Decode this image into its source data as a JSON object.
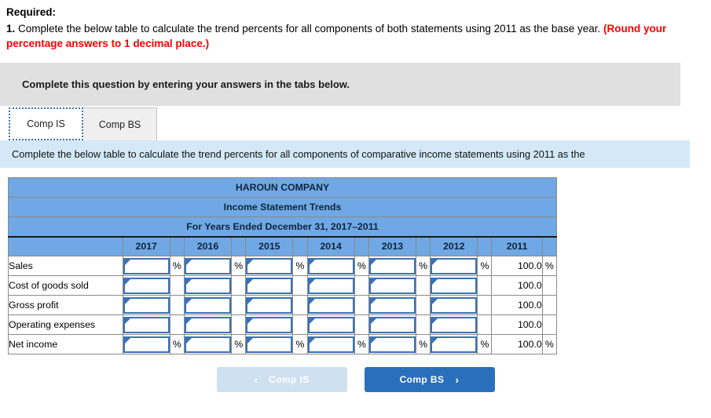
{
  "prompt": {
    "required_label": "Required:",
    "item_number": "1.",
    "item_text": " Complete the below table to calculate the trend percents for all components of both statements using 2011 as the base year.",
    "rounding_note": "(Round your percentage answers to 1 decimal place.)",
    "red_color": "#ff0000"
  },
  "gray_banner": {
    "text": "Complete this question by entering your answers in the tabs below."
  },
  "tabs": [
    {
      "label": "Comp IS",
      "active": true
    },
    {
      "label": "Comp BS",
      "active": false
    }
  ],
  "blue_strip": {
    "text": "Complete the below table to calculate the trend percents for all components of comparative income statements using 2011 as the"
  },
  "table": {
    "title_lines": [
      "HAROUN COMPANY",
      "Income Statement Trends",
      "For Years Ended December 31, 2017–2011"
    ],
    "year_columns": [
      "2017",
      "2016",
      "2015",
      "2014",
      "2013",
      "2012",
      "2011"
    ],
    "percent_symbol": "%",
    "rows": [
      {
        "label": "Sales",
        "inputs": 6,
        "show_percent": true,
        "base_value": "100.0",
        "base_percent": "%"
      },
      {
        "label": "Cost of goods sold",
        "inputs": 6,
        "show_percent": false,
        "base_value": "100.0",
        "base_percent": ""
      },
      {
        "label": "Gross profit",
        "inputs": 6,
        "show_percent": false,
        "base_value": "100.0",
        "base_percent": ""
      },
      {
        "label": "Operating expenses",
        "inputs": 6,
        "show_percent": false,
        "base_value": "100.0",
        "base_percent": ""
      },
      {
        "label": "Net income",
        "inputs": 6,
        "show_percent": true,
        "base_value": "100.0",
        "base_percent": "%"
      }
    ],
    "header_bg": "#6fa8e4",
    "input_border": "#3b72b5"
  },
  "nav": {
    "prev_label": "Comp IS",
    "prev_chevron": "‹",
    "next_label": "Comp BS",
    "next_chevron": "›",
    "prev_bg": "#cfe0f0",
    "next_bg": "#2a6fbb"
  }
}
